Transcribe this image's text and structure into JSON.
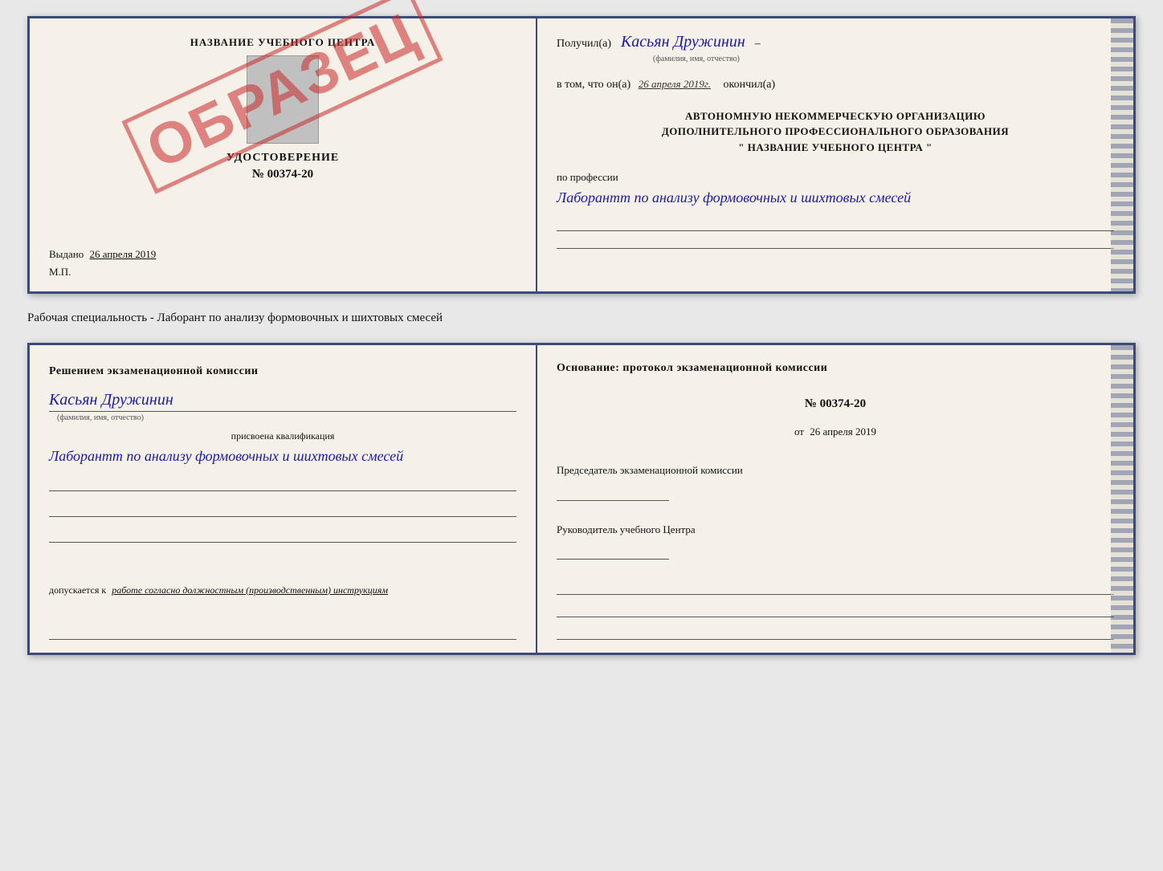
{
  "page": {
    "background": "#e8e8e8"
  },
  "top_doc": {
    "left": {
      "center_title": "НАЗВАНИЕ УЧЕБНОГО ЦЕНТРА",
      "cert_label": "УДОСТОВЕРЕНИЕ",
      "cert_number": "№ 00374-20",
      "issued_prefix": "Выдано",
      "issued_date": "26 апреля 2019",
      "mp_label": "М.П.",
      "obrazec": "ОБРАЗЕЦ"
    },
    "right": {
      "received_prefix": "Получил(а)",
      "recipient_name": "Касьян Дружинин",
      "name_sublabel": "(фамилия, имя, отчество)",
      "completed_prefix": "в том, что он(а)",
      "completed_date": "26 апреля 2019г.",
      "completed_suffix": "окончил(а)",
      "org_line1": "АВТОНОМНУЮ НЕКОММЕРЧЕСКУЮ ОРГАНИЗАЦИЮ",
      "org_line2": "ДОПОЛНИТЕЛЬНОГО ПРОФЕССИОНАЛЬНОГО ОБРАЗОВАНИЯ",
      "org_line3": "\"  НАЗВАНИЕ УЧЕБНОГО ЦЕНТРА  \"",
      "profession_label": "по профессии",
      "profession_text": "Лаборантт по анализу формовочных и шихтовых смесей"
    }
  },
  "specialty_line": "Рабочая специальность - Лаборант по анализу формовочных и шихтовых смесей",
  "bottom_doc": {
    "left": {
      "commission_title": "Решением экзаменационной комиссии",
      "person_name": "Касьян Дружинин",
      "person_sublabel": "(фамилия, имя, отчество)",
      "qualification_label": "присвоена квалификация",
      "qualification_text": "Лаборантт по анализу формовочных и шихтовых смесей",
      "admission_prefix": "допускается к",
      "admission_text": "работе согласно должностным (производственным) инструкциям"
    },
    "right": {
      "basis_title": "Основание: протокол экзаменационной комиссии",
      "protocol_number": "№ 00374-20",
      "protocol_date_prefix": "от",
      "protocol_date": "26 апреля 2019",
      "chairman_label": "Председатель экзаменационной комиссии",
      "director_label": "Руководитель учебного Центра"
    }
  }
}
